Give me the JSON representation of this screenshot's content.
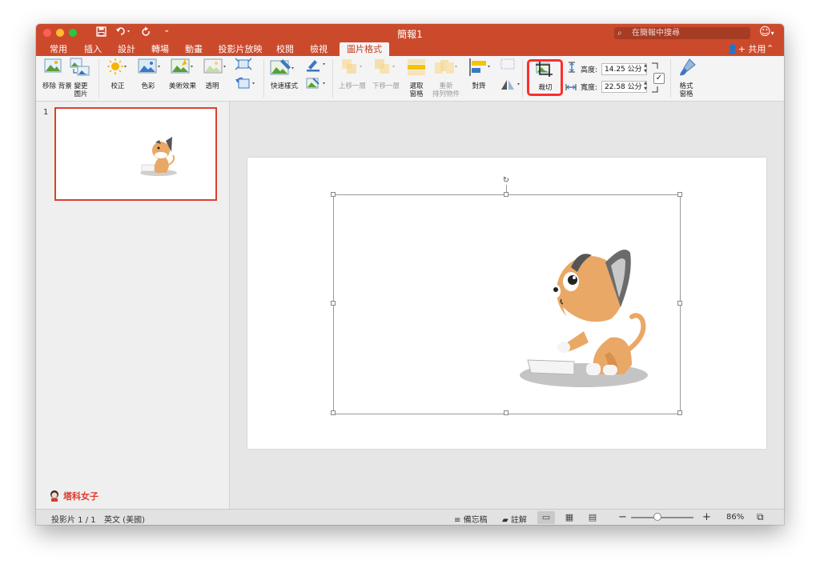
{
  "window": {
    "title": "簡報1",
    "search_placeholder": "在簡報中搜尋",
    "share_label": "共用"
  },
  "tabs": [
    {
      "label": "常用",
      "active": false
    },
    {
      "label": "插入",
      "active": false
    },
    {
      "label": "設計",
      "active": false
    },
    {
      "label": "轉場",
      "active": false
    },
    {
      "label": "動畫",
      "active": false
    },
    {
      "label": "投影片放映",
      "active": false
    },
    {
      "label": "校閱",
      "active": false
    },
    {
      "label": "檢視",
      "active": false
    },
    {
      "label": "圖片格式",
      "active": true
    }
  ],
  "ribbon": {
    "remove_bg": "移除\n背景",
    "change_pic": "變更\n圖片",
    "corrections": "校正",
    "color": "色彩",
    "artistic": "美術效果",
    "transparency": "透明",
    "quick_styles": "快速樣式",
    "bring_forward": "上移一層",
    "send_backward": "下移一層",
    "selection_pane": "選取\n窗格",
    "reorder": "重新\n排列物件",
    "align": "對齊",
    "crop": "裁切",
    "height_label": "高度:",
    "height_value": "14.25 公分",
    "width_label": "寬度:",
    "width_value": "22.58 公分",
    "format_pane": "格式\n窗格"
  },
  "slides_pane": {
    "slide_number": "1"
  },
  "brand": "塔科女子",
  "status": {
    "slide_info": "投影片 1 / 1",
    "language": "英文 (美國)",
    "notes": "備忘稿",
    "comments": "註解",
    "zoom": "86%",
    "zoom_level": 0.58
  },
  "colors": {
    "accent": "#cc4a2c",
    "crop_highlight": "#ff2d2d",
    "thumb_border": "#d6432a"
  }
}
